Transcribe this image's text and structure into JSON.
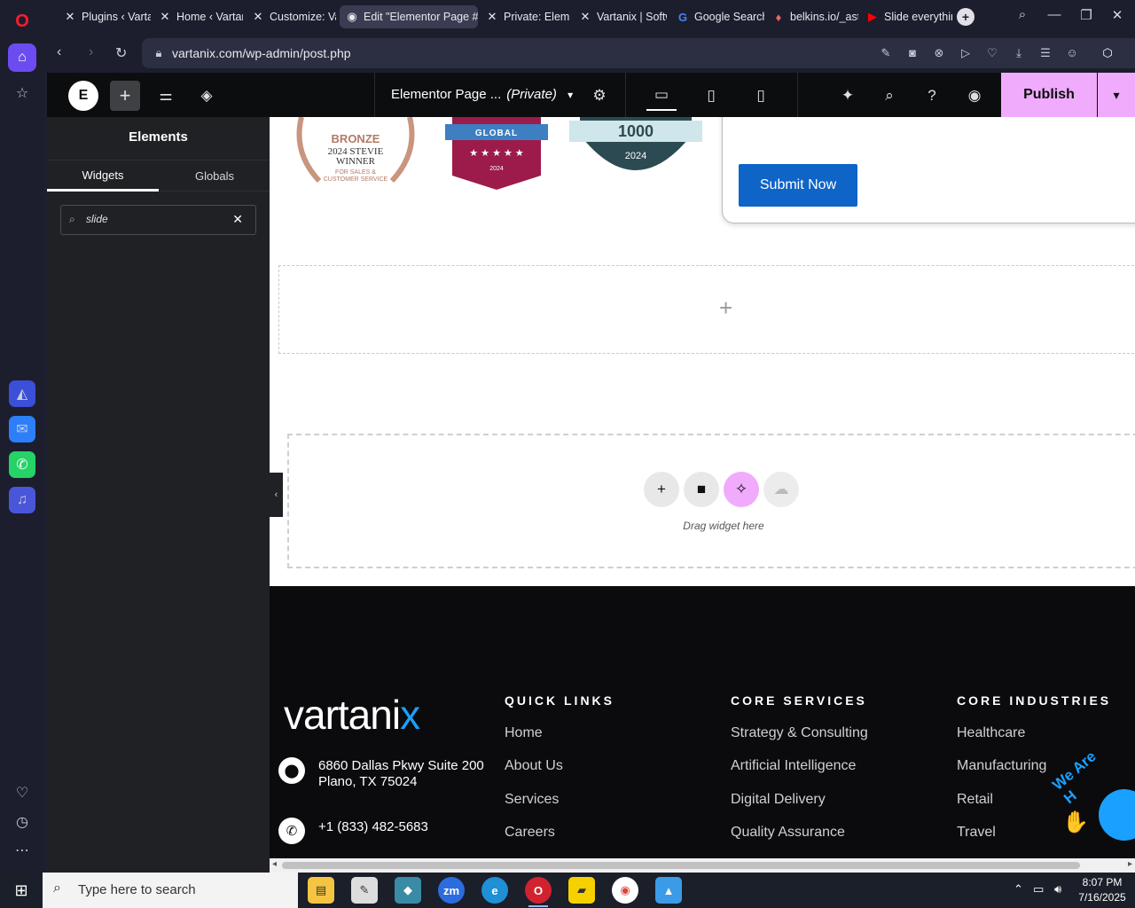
{
  "browser": {
    "tabs": [
      {
        "label": "Plugins ‹ Varta",
        "favicon": "x-icon"
      },
      {
        "label": "Home ‹ Vartan",
        "favicon": "x-icon"
      },
      {
        "label": "Customize: Va",
        "favicon": "x-icon"
      },
      {
        "label": "Edit \"Elementor Page #1",
        "favicon": "globe-icon"
      },
      {
        "label": "Private: Elemen",
        "favicon": "x-icon"
      },
      {
        "label": "Vartanix | Softw",
        "favicon": "x-icon"
      },
      {
        "label": "Google Search",
        "favicon": "google-icon"
      },
      {
        "label": "belkins.io/_ast",
        "favicon": "flame-icon"
      },
      {
        "label": "Slide everythin",
        "favicon": "youtube-icon"
      }
    ],
    "url": "vartanix.com/wp-admin/post.php"
  },
  "elementor": {
    "page_name": "Elementor Page ...",
    "page_status": "(Private)",
    "publish_label": "Publish",
    "panel": {
      "title": "Elements",
      "tabs": [
        "Widgets",
        "Globals"
      ],
      "search_value": "slide"
    }
  },
  "canvas": {
    "badges": {
      "bronze_line1": "BRONZE",
      "bronze_line2": "2024 STEVIE",
      "bronze_line3": "WINNER",
      "bronze_line4": "FOR SALES &",
      "bronze_line5": "CUSTOMER SERVICE",
      "global_label": "GLOBAL",
      "global_year": "2024",
      "thousand_label": "1000",
      "thousand_year": "2024"
    },
    "submit_label": "Submit Now",
    "dropzone_hint": "Drag widget here"
  },
  "footer": {
    "logo_main": "vartani",
    "logo_accent": "x",
    "address_line1": "6860 Dallas Pkwy Suite 200",
    "address_line2": "Plano, TX 75024",
    "phone": "+1 (833) 482-5683",
    "columns": [
      {
        "heading": "QUICK LINKS",
        "links": [
          "Home",
          "About Us",
          "Services",
          "Careers"
        ]
      },
      {
        "heading": "CORE SERVICES",
        "links": [
          "Strategy & Consulting",
          "Artificial Intelligence",
          "Digital Delivery",
          "Quality Assurance"
        ]
      },
      {
        "heading": "CORE INDUSTRIES",
        "links": [
          "Healthcare",
          "Manufacturing",
          "Retail",
          "Travel"
        ]
      }
    ],
    "chat_teaser": "We Are H"
  },
  "taskbar": {
    "search_placeholder": "Type here to search",
    "time": "8:07 PM",
    "date": "7/16/2025"
  },
  "colors": {
    "accent": "#6c4cf0",
    "publish": "#f0abfc",
    "submit": "#0f64c8",
    "brand": "#1aa0ff"
  }
}
